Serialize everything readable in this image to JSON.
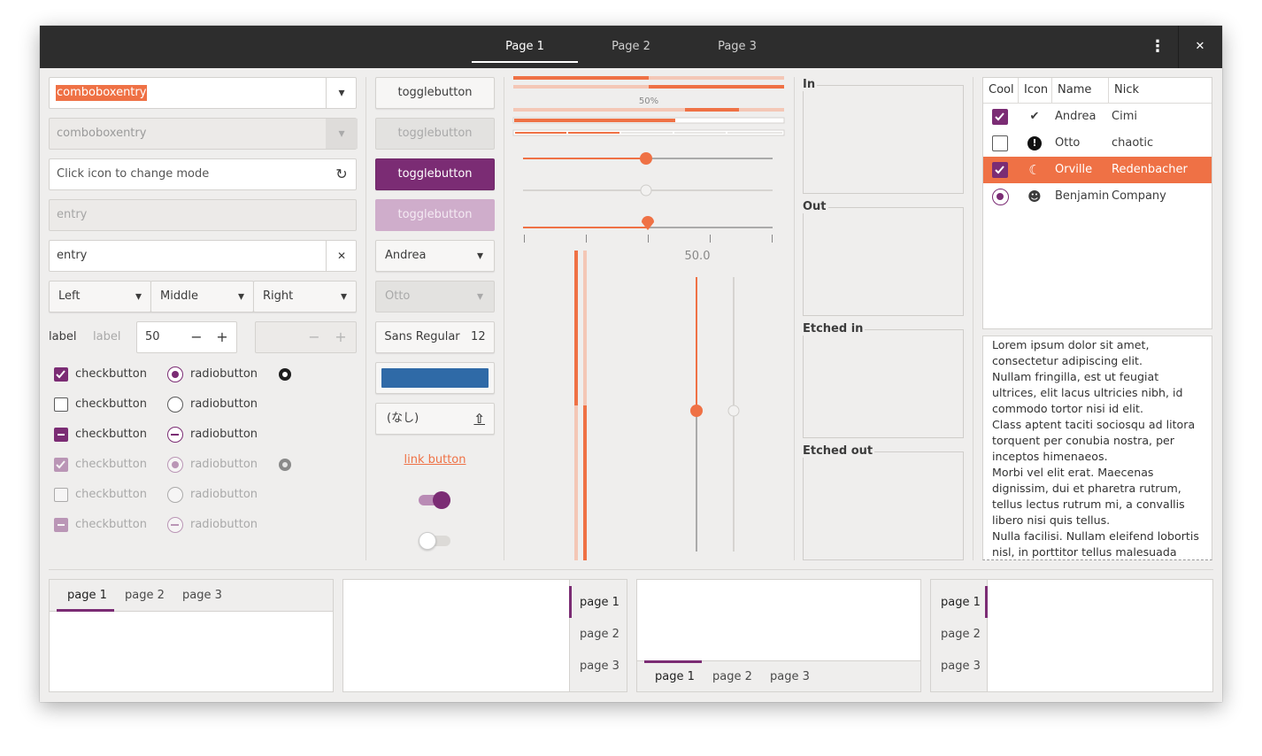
{
  "colors": {
    "accent": "#ef7145",
    "purple": "#7b2c74",
    "titlebar": "#2d2d2d",
    "bg": "#efeeed",
    "blue": "#2f6aa7"
  },
  "titlebar": {
    "tabs": [
      {
        "label": "Page 1",
        "active": true
      },
      {
        "label": "Page 2",
        "active": false
      },
      {
        "label": "Page 3",
        "active": false
      }
    ],
    "menu_icon": "⋮",
    "close_icon": "✕"
  },
  "left": {
    "combo1": {
      "value": "comboboxentry"
    },
    "combo2": {
      "value": "comboboxentry"
    },
    "entry_icon": {
      "placeholder": "Click icon to change mode",
      "icon": "↻"
    },
    "entry_disabled": {
      "value": "entry"
    },
    "entry_clear": {
      "value": "entry",
      "icon": "✕"
    },
    "linked": [
      {
        "label": "Left"
      },
      {
        "label": "Middle"
      },
      {
        "label": "Right"
      }
    ],
    "label1": "label",
    "label2": "label",
    "spin1": {
      "value": "50",
      "minus": "−",
      "plus": "+"
    },
    "spin2": {
      "minus": "−",
      "plus": "+"
    },
    "checks": [
      {
        "label": "checkbutton"
      },
      {
        "label": "checkbutton"
      },
      {
        "label": "checkbutton"
      },
      {
        "label": "checkbutton"
      },
      {
        "label": "checkbutton"
      },
      {
        "label": "checkbutton"
      }
    ],
    "radios": [
      {
        "label": "radiobutton"
      },
      {
        "label": "radiobutton"
      },
      {
        "label": "radiobutton"
      },
      {
        "label": "radiobutton"
      },
      {
        "label": "radiobutton"
      },
      {
        "label": "radiobutton"
      }
    ]
  },
  "middle": {
    "toggles": [
      {
        "label": "togglebutton"
      },
      {
        "label": "togglebutton"
      },
      {
        "label": "togglebutton"
      },
      {
        "label": "togglebutton"
      }
    ],
    "combo_a": {
      "value": "Andrea"
    },
    "combo_b": {
      "value": "Otto"
    },
    "font": {
      "family": "Sans Regular",
      "size": "12"
    },
    "file": {
      "value": "(なし)",
      "icon": "⇧"
    },
    "link": "link button",
    "switch_on": true,
    "switch_off": false
  },
  "sliders": {
    "progress_label": "50%",
    "progress1": 0.5,
    "scale_value": "50.0",
    "hscale1": 0.5,
    "hscale2": 0.5,
    "hscale3": 0.5
  },
  "frames": [
    {
      "label": "In"
    },
    {
      "label": "Out"
    },
    {
      "label": "Etched in"
    },
    {
      "label": "Etched out"
    }
  ],
  "tree": {
    "columns": [
      "Cool",
      "Icon",
      "Name",
      "Nick"
    ],
    "rows": [
      {
        "cool": "check",
        "icon": "✔",
        "name": "Andrea",
        "nick": "Cimi",
        "selected": false
      },
      {
        "cool": "empty",
        "icon": "!",
        "name": "Otto",
        "nick": "chaotic",
        "selected": false
      },
      {
        "cool": "check",
        "icon": "☾",
        "name": "Orville",
        "nick": "Redenbacher",
        "selected": true
      },
      {
        "cool": "radio",
        "icon": "☻",
        "name": "Benjamin",
        "nick": "Company",
        "selected": false
      }
    ]
  },
  "textview": {
    "lines": [
      "Lorem ipsum dolor sit amet,",
      "consectetur adipiscing elit.",
      "Nullam fringilla, est ut feugiat",
      "ultrices, elit lacus ultricies nibh, id",
      "commodo tortor nisi id elit.",
      "Class aptent taciti sociosqu ad litora",
      "torquent per conubia nostra, per",
      "inceptos himenaeos.",
      "Morbi vel elit erat. Maecenas",
      "dignissim, dui et pharetra rutrum,",
      "tellus lectus rutrum mi, a convallis",
      "libero nisi quis tellus.",
      "Nulla facilisi. Nullam eleifend lobortis",
      "nisl, in porttitor tellus malesuada"
    ]
  },
  "notebooks": {
    "tabs": [
      "page 1",
      "page 2",
      "page 3"
    ]
  }
}
